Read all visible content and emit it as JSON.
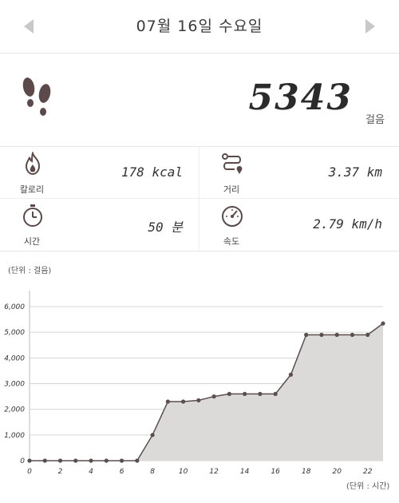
{
  "header": {
    "date_title": "07월 16일 수요일",
    "prev_icon": "triangle-left-icon",
    "next_icon": "triangle-right-icon"
  },
  "steps": {
    "icon": "footprints-icon",
    "value": "5343",
    "unit": "걸음"
  },
  "stats": {
    "calories": {
      "icon": "flame-icon",
      "label": "칼로리",
      "value": "178 kcal"
    },
    "distance": {
      "icon": "route-icon",
      "label": "거리",
      "value": "3.37 km"
    },
    "time": {
      "icon": "stopwatch-icon",
      "label": "시간",
      "value": "50 분"
    },
    "speed": {
      "icon": "speedometer-icon",
      "label": "속도",
      "value": "2.79 km/h"
    }
  },
  "chart_units": {
    "y": "(단위 : 걸음)",
    "x": "(단위 : 시간)"
  },
  "chart_data": {
    "type": "area",
    "title": "",
    "xlabel": "(단위 : 시간)",
    "ylabel": "(단위 : 걸음)",
    "x": [
      0,
      1,
      2,
      3,
      4,
      5,
      6,
      7,
      8,
      9,
      10,
      11,
      12,
      13,
      14,
      15,
      16,
      17,
      18,
      19,
      20,
      21,
      22,
      23
    ],
    "values": [
      0,
      0,
      0,
      0,
      0,
      0,
      0,
      0,
      1000,
      2300,
      2300,
      2350,
      2500,
      2600,
      2600,
      2600,
      2600,
      3350,
      4900,
      4900,
      4900,
      4900,
      4900,
      5343
    ],
    "xlim": [
      0,
      23
    ],
    "ylim": [
      0,
      6000
    ],
    "x_ticks": [
      "0",
      "2",
      "4",
      "6",
      "8",
      "10",
      "12",
      "14",
      "16",
      "18",
      "20",
      "22"
    ],
    "y_ticks": [
      "0",
      "1,000",
      "2,000",
      "3,000",
      "4,000",
      "5,000",
      "6,000"
    ],
    "grid": true,
    "colors": {
      "line": "#5a4e4e",
      "fill": "#dcdad8",
      "marker": "#5a4e4e"
    }
  }
}
